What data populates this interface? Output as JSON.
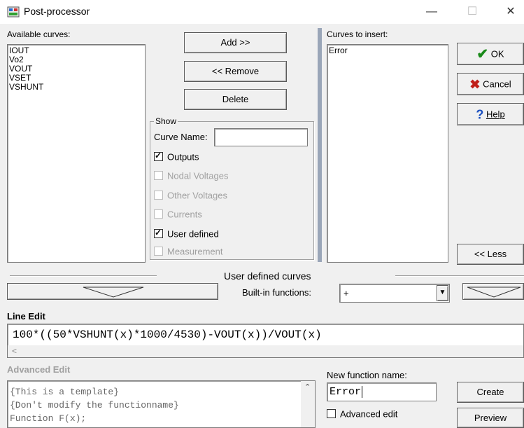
{
  "window": {
    "title": "Post-processor",
    "minimize": "—",
    "maximize": "☐",
    "close": "✕"
  },
  "available_curves": {
    "label": "Available curves:",
    "items": [
      "IOUT",
      "Vo2",
      "VOUT",
      "VSET",
      "VSHUNT"
    ]
  },
  "buttons": {
    "add": "Add >>",
    "remove": "<< Remove",
    "delete": "Delete"
  },
  "show": {
    "legend": "Show",
    "curve_name_label": "Curve Name:",
    "curve_name_value": "",
    "options": [
      {
        "label": "Outputs",
        "checked": true,
        "enabled": true
      },
      {
        "label": "Nodal Voltages",
        "checked": false,
        "enabled": false
      },
      {
        "label": "Other Voltages",
        "checked": false,
        "enabled": false
      },
      {
        "label": "Currents",
        "checked": false,
        "enabled": false
      },
      {
        "label": "User defined",
        "checked": true,
        "enabled": true
      },
      {
        "label": "Measurement",
        "checked": false,
        "enabled": false
      }
    ]
  },
  "curves_to_insert": {
    "label": "Curves to insert:",
    "items": [
      "Error"
    ]
  },
  "right_buttons": {
    "ok": "OK",
    "cancel": "Cancel",
    "help": "Help",
    "less": "<< Less"
  },
  "user_defined": {
    "title": "User defined curves",
    "builtin_label": "Built-in functions:",
    "builtin_value": "+"
  },
  "line_edit": {
    "label": "Line Edit",
    "value": "100*((50*VSHUNT(x)*1000/4530)-VOUT(x))/VOUT(x)",
    "scroll_left": "<"
  },
  "advanced_edit": {
    "label": "Advanced Edit",
    "lines": [
      "{This is a template}",
      "{Don't modify the functionname}",
      "Function F(x);"
    ]
  },
  "new_function": {
    "label": "New function name:",
    "value": "Error",
    "advanced_checkbox": "Advanced edit",
    "advanced_checked": false
  },
  "bottom_buttons": {
    "create": "Create",
    "preview": "Preview"
  },
  "colors": {
    "ok_check": "#1a8a1a",
    "cancel_x": "#c0201a",
    "help_q": "#1a4fc0",
    "disabled_text": "#a0a0a0"
  }
}
